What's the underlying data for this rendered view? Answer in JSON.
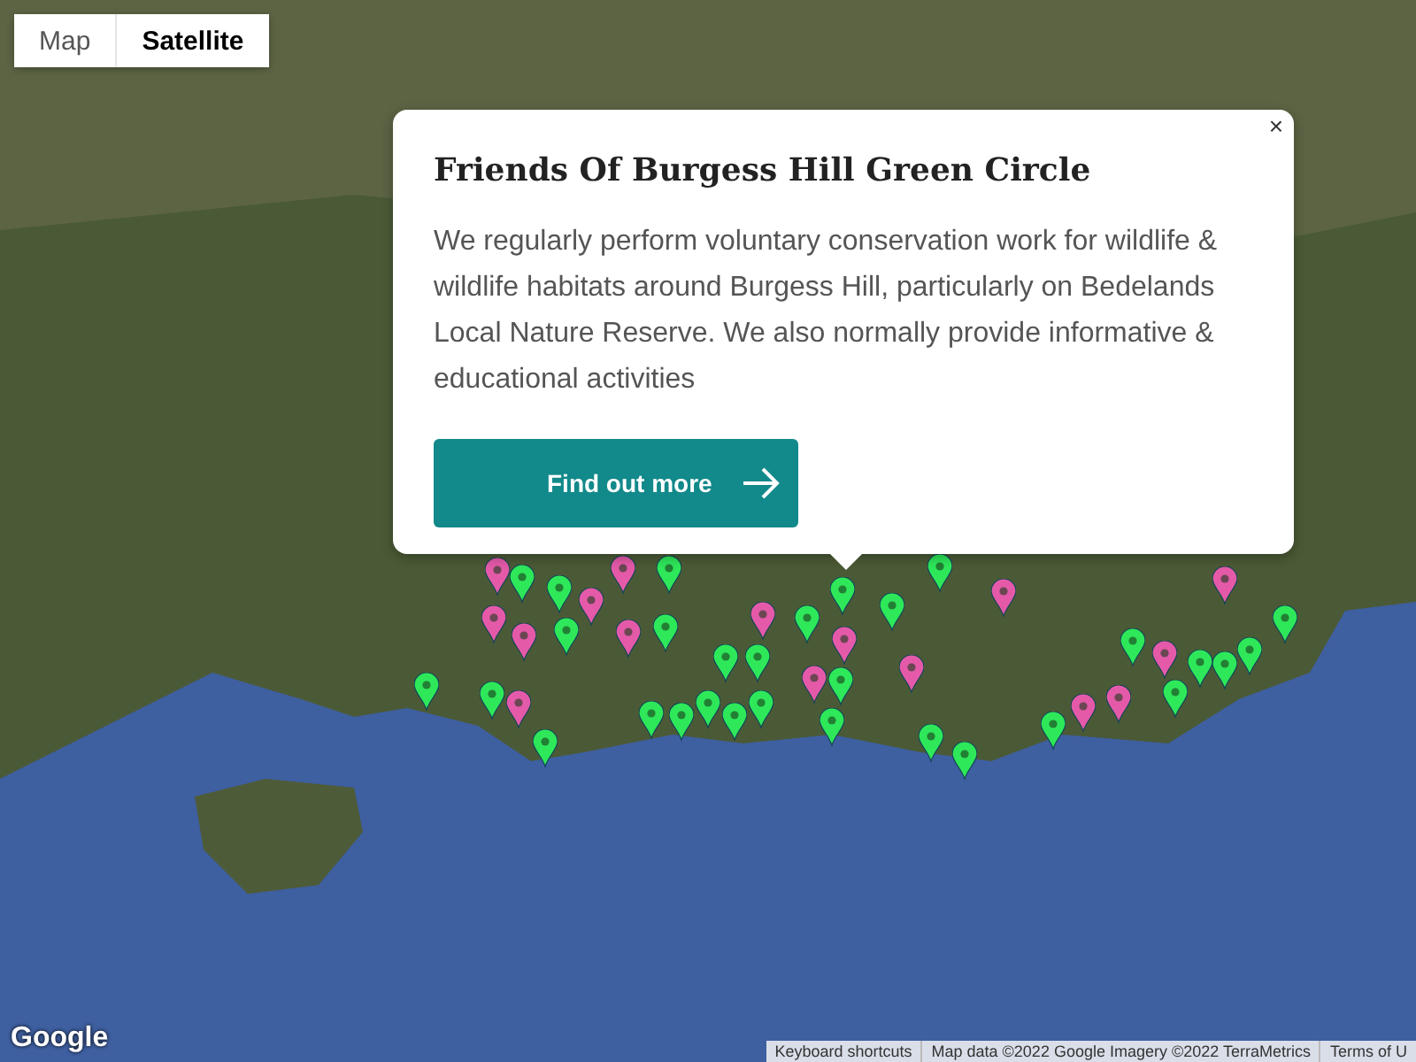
{
  "map_type_tabs": [
    {
      "label": "Map",
      "selected": false
    },
    {
      "label": "Satellite",
      "selected": true
    }
  ],
  "info_window": {
    "close": "×",
    "title": "Friends Of Burgess Hill Green Circle",
    "description": "We regularly perform voluntary conservation work for wildlife & wildlife habitats around Burgess Hill, particularly on Bedelands Local Nature Reserve. We also normally provide informative & educational activities",
    "button": "Find out more"
  },
  "markers": [
    {
      "color": "#e45aa8"
    },
    {
      "color": "#e45aa8"
    },
    {
      "color": "#e45aa8"
    },
    {
      "color": "#e45aa8"
    },
    {
      "color": "#e45aa8"
    },
    {
      "color": "#e45aa8"
    },
    {
      "color": "#e45aa8"
    },
    {
      "color": "#e45aa8"
    },
    {
      "color": "#e45aa8"
    },
    {
      "color": "#e45aa8"
    },
    {
      "color": "#e45aa8"
    },
    {
      "color": "#e45aa8"
    },
    {
      "color": "#e45aa8"
    },
    {
      "color": "#e45aa8"
    },
    {
      "color": "#e45aa8"
    },
    {
      "color": "#e45aa8"
    },
    {
      "color": "#2ee85a"
    },
    {
      "color": "#2ee85a"
    },
    {
      "color": "#2ee85a"
    },
    {
      "color": "#2ee85a"
    },
    {
      "color": "#2ee85a"
    },
    {
      "color": "#2ee85a"
    },
    {
      "color": "#2ee85a"
    },
    {
      "color": "#2ee85a"
    },
    {
      "color": "#2ee85a"
    },
    {
      "color": "#2ee85a"
    },
    {
      "color": "#2ee85a"
    },
    {
      "color": "#2ee85a"
    },
    {
      "color": "#2ee85a"
    },
    {
      "color": "#2ee85a"
    },
    {
      "color": "#2ee85a"
    },
    {
      "color": "#2ee85a"
    },
    {
      "color": "#2ee85a"
    },
    {
      "color": "#2ee85a"
    },
    {
      "color": "#2ee85a"
    },
    {
      "color": "#2ee85a"
    },
    {
      "color": "#2ee85a"
    },
    {
      "color": "#2ee85a"
    },
    {
      "color": "#2ee85a"
    },
    {
      "color": "#2ee85a"
    },
    {
      "color": "#2ee85a"
    },
    {
      "color": "#2ee85a"
    },
    {
      "color": "#2ee85a"
    },
    {
      "color": "#2ee85a"
    },
    {
      "color": "#2ee85a"
    },
    {
      "color": "#2ee85a"
    }
  ],
  "logo": "Google",
  "attribution": [
    "Keyboard shortcuts",
    "Map data ©2022 Google Imagery ©2022 TerraMetrics",
    "Terms of U"
  ]
}
